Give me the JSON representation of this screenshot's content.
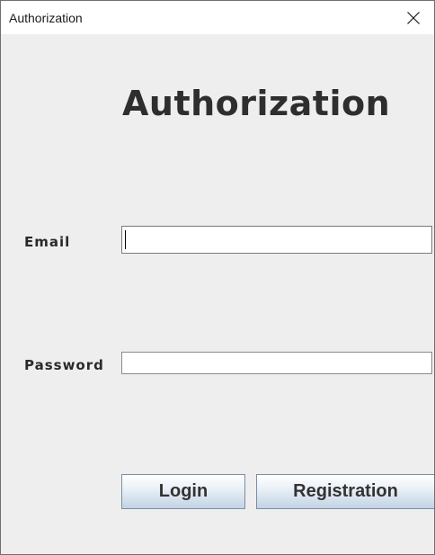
{
  "window": {
    "title": "Authorization"
  },
  "form": {
    "heading": "Authorization",
    "email_label": "Email",
    "email_value": "",
    "password_label": "Password",
    "password_value": ""
  },
  "buttons": {
    "login_label": "Login",
    "registration_label": "Registration"
  },
  "icons": {
    "close": "close-icon"
  },
  "colors": {
    "background": "#eeeeee",
    "titlebar": "#ffffff",
    "heading_text": "#2e2e2e",
    "button_gradient_top": "#ffffff",
    "button_gradient_bottom": "#c2d3e4"
  }
}
